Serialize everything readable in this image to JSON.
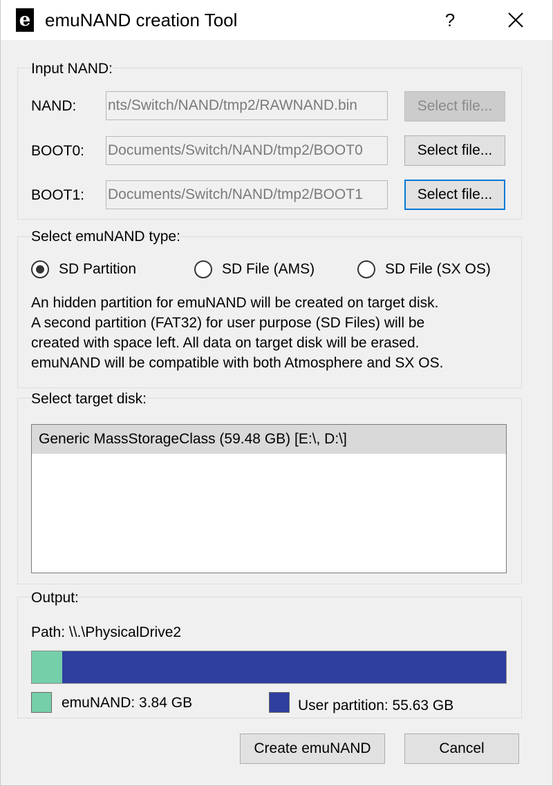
{
  "window": {
    "title": "emuNAND creation Tool",
    "help_label": "?",
    "close_icon": "close-icon",
    "app_icon_letter": "e"
  },
  "input_nand": {
    "group_label": "Input NAND:",
    "rows": [
      {
        "label": "NAND:",
        "path": "nts/Switch/NAND/tmp2/RAWNAND.bin",
        "button": "Select file...",
        "button_state": "disabled"
      },
      {
        "label": "BOOT0:",
        "path": "Documents/Switch/NAND/tmp2/BOOT0",
        "button": "Select file...",
        "button_state": "normal"
      },
      {
        "label": "BOOT1:",
        "path": "Documents/Switch/NAND/tmp2/BOOT1",
        "button": "Select file...",
        "button_state": "focused"
      }
    ]
  },
  "emunand_type": {
    "group_label": "Select emuNAND type:",
    "options": [
      {
        "label": "SD Partition",
        "checked": true
      },
      {
        "label": "SD File (AMS)",
        "checked": false
      },
      {
        "label": "SD File (SX OS)",
        "checked": false
      }
    ],
    "description_lines": [
      "An hidden partition for emuNAND will be created on target disk.",
      "A second partition (FAT32) for user purpose (SD Files) will be",
      "created with space left. All data on target disk will be erased.",
      "emuNAND will be compatible with both Atmosphere and SX OS."
    ]
  },
  "target_disk": {
    "group_label": "Select target disk:",
    "items": [
      "Generic MassStorageClass (59.48 GB) [E:\\, D:\\]"
    ]
  },
  "output": {
    "group_label": "Output:",
    "path_text": "Path: \\\\.\\PhysicalDrive2",
    "emunand_fraction": 0.0646,
    "colors": {
      "emunand": "#75cfa8",
      "user": "#2e3fa0"
    },
    "legend": {
      "emunand": "emuNAND: 3.84 GB",
      "user": "User partition: 55.63 GB"
    }
  },
  "footer": {
    "create_label": "Create emuNAND",
    "cancel_label": "Cancel"
  }
}
